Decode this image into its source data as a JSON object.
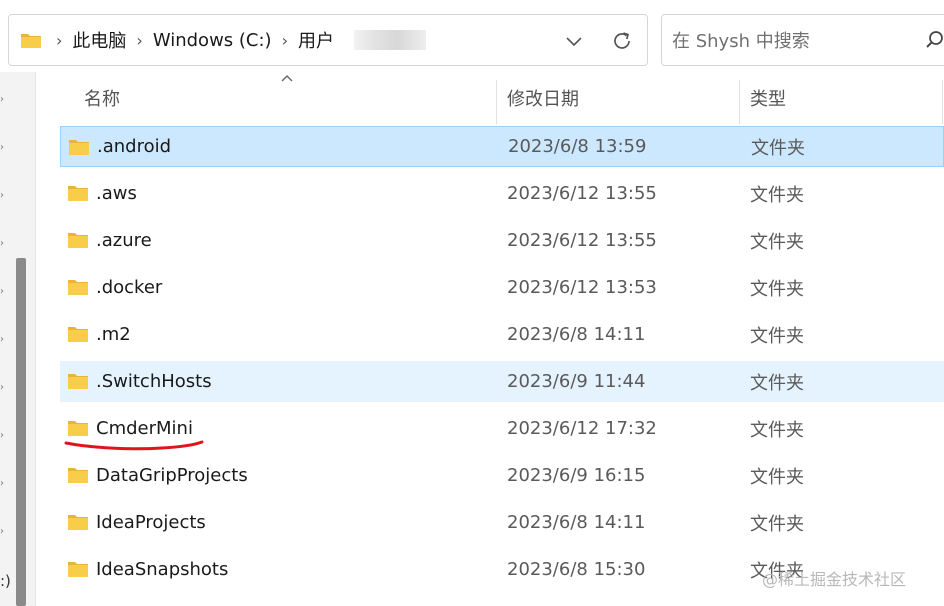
{
  "address_bar": {
    "segments": [
      "此电脑",
      "Windows  (C:)",
      "用户"
    ],
    "separator": "›"
  },
  "search": {
    "placeholder": "在 Shysh 中搜索"
  },
  "columns": {
    "name": "名称",
    "date": "修改日期",
    "type": "类型"
  },
  "left_pane": {
    "drive_fragment": ":)"
  },
  "files": [
    {
      "name": ".android",
      "date": "2023/6/8 13:59",
      "type": "文件夹"
    },
    {
      "name": ".aws",
      "date": "2023/6/12 13:55",
      "type": "文件夹"
    },
    {
      "name": ".azure",
      "date": "2023/6/12 13:55",
      "type": "文件夹"
    },
    {
      "name": ".docker",
      "date": "2023/6/12 13:53",
      "type": "文件夹"
    },
    {
      "name": ".m2",
      "date": "2023/6/8 14:11",
      "type": "文件夹"
    },
    {
      "name": ".SwitchHosts",
      "date": "2023/6/9 11:44",
      "type": "文件夹"
    },
    {
      "name": "CmderMini",
      "date": "2023/6/12 17:32",
      "type": "文件夹"
    },
    {
      "name": "DataGripProjects",
      "date": "2023/6/9 16:15",
      "type": "文件夹"
    },
    {
      "name": "IdeaProjects",
      "date": "2023/6/8 14:11",
      "type": "文件夹"
    },
    {
      "name": "IdeaSnapshots",
      "date": "2023/6/8 15:30",
      "type": "文件夹"
    }
  ],
  "selected_index": 0,
  "hover_index": 5,
  "watermark": "@稀土掘金技术社区",
  "colors": {
    "selected_bg": "#cce8ff",
    "hover_bg": "#e5f3ff",
    "folder_yellow": "#f8cd4a",
    "annotation_red": "#e0141a"
  }
}
